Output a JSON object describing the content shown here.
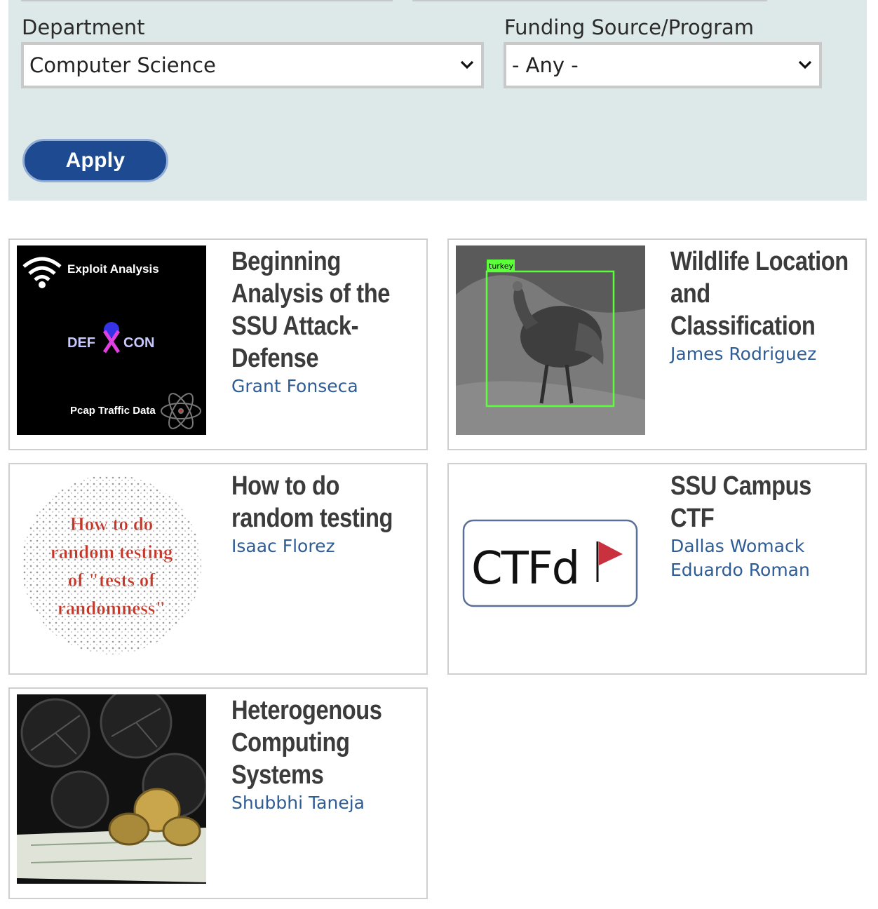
{
  "filters": {
    "department": {
      "label": "Department",
      "selected": "Computer Science"
    },
    "funding": {
      "label": "Funding Source/Program",
      "selected": "- Any -"
    },
    "apply_label": "Apply"
  },
  "projects": [
    {
      "title": "Beginning Analysis of the SSU Attack-Defense",
      "authors": [
        "Grant Fonseca"
      ],
      "thumb": {
        "heading": "Exploit Analysis",
        "logo_left": "DEF",
        "logo_right": "CON",
        "footer": "Pcap Traffic Data"
      }
    },
    {
      "title": "Wildlife Location and Classification",
      "authors": [
        "James Rodriguez"
      ],
      "thumb": {
        "tag": "turkey"
      }
    },
    {
      "title": "How to do random testing",
      "authors": [
        "Isaac Florez"
      ],
      "thumb": {
        "line1": "How to do",
        "line2": "random testing",
        "line3": "of \"tests of",
        "line4": "randomness\""
      }
    },
    {
      "title": "SSU Campus CTF",
      "authors": [
        "Dallas Womack",
        "Eduardo Roman"
      ],
      "thumb": {
        "logo": "CTFd"
      }
    },
    {
      "title": "Heterogenous Computing Systems",
      "authors": [
        "Shubbhi Taneja"
      ],
      "thumb": {}
    }
  ],
  "colors": {
    "panel": "#dde9e8",
    "button": "#1d4a91",
    "link": "#2e5c94",
    "title": "#3b3b3b"
  }
}
